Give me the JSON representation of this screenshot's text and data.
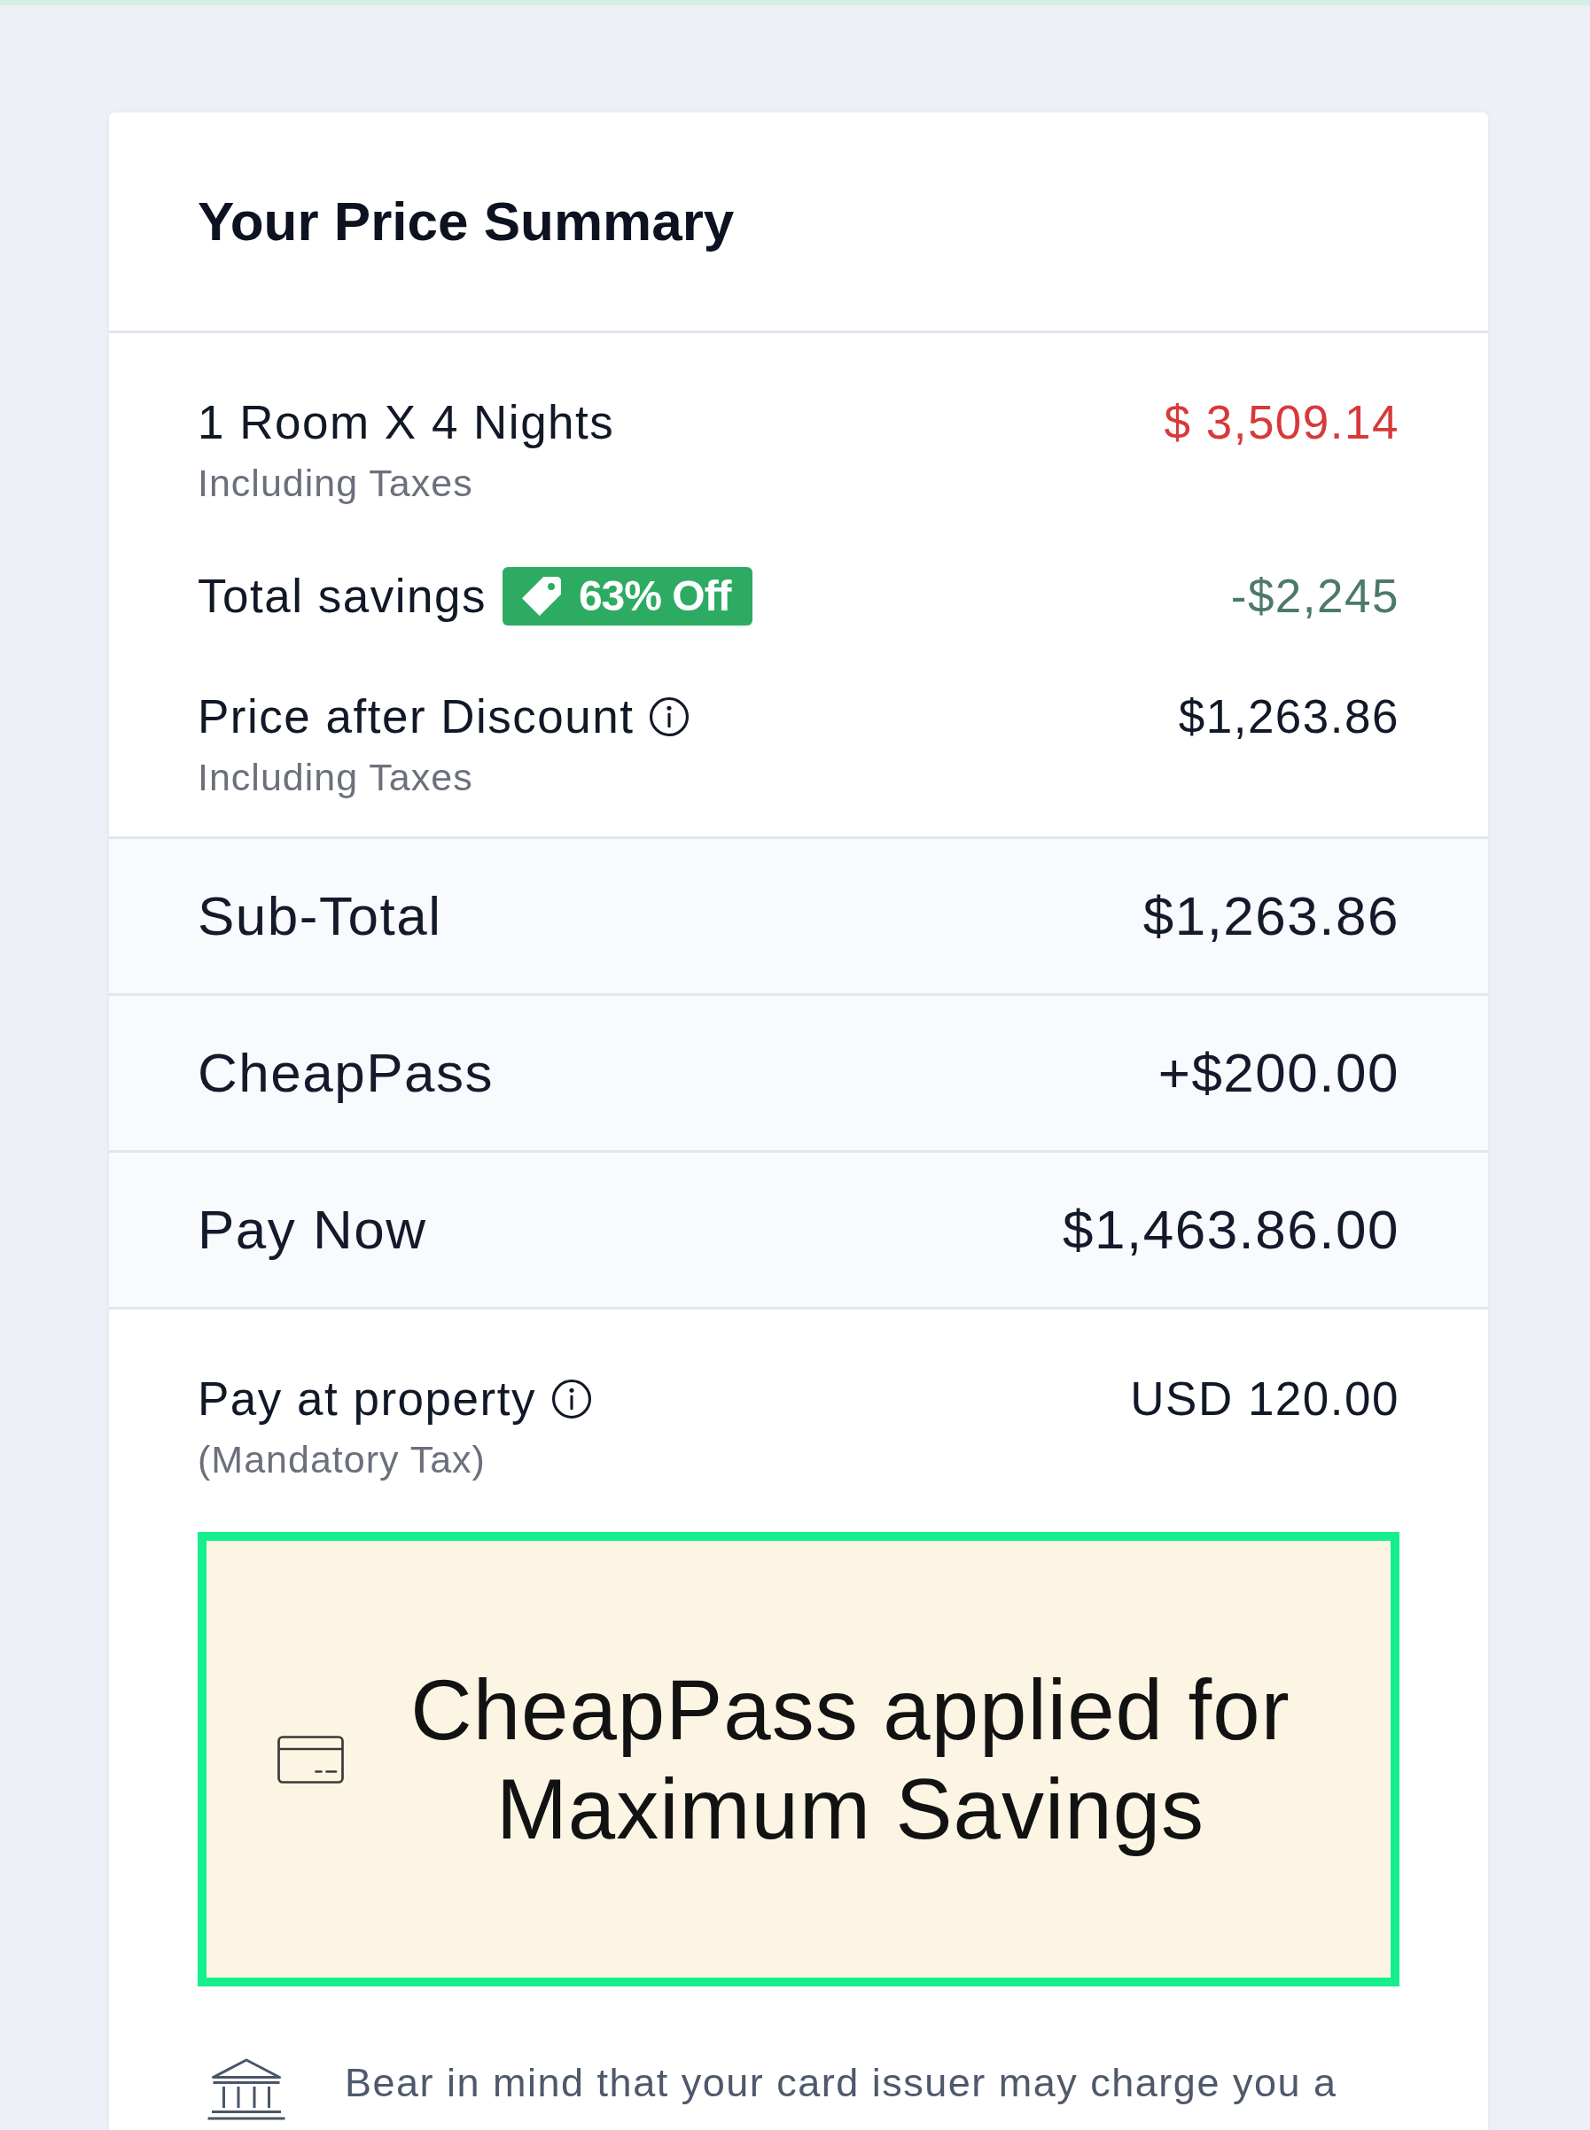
{
  "title": "Your Price Summary",
  "price_lines": [
    {
      "kind": "original",
      "label": "1 Room X 4 Nights",
      "note": "Including Taxes",
      "amount": "$ 3,509.14"
    },
    {
      "kind": "savings",
      "label": "Total savings",
      "badge": "63% Off",
      "amount": "-$2,245"
    },
    {
      "kind": "discounted",
      "label": "Price after Discount",
      "info": true,
      "note": "Including Taxes",
      "amount": "$1,263.86"
    }
  ],
  "totals": [
    {
      "label": "Sub-Total",
      "amount": "$1,263.86"
    },
    {
      "label": "CheapPass",
      "amount": "+$200.00"
    },
    {
      "label": "Pay Now",
      "amount": "$1,463.86.00"
    }
  ],
  "pay_at_property": {
    "label": "Pay at property",
    "info": true,
    "note": "(Mandatory Tax)",
    "amount": "USD 120.00"
  },
  "banner": {
    "text": "CheapPass applied for Maximum Savings"
  },
  "notice": {
    "text": "Bear in mind that your card issuer may charge you a"
  }
}
